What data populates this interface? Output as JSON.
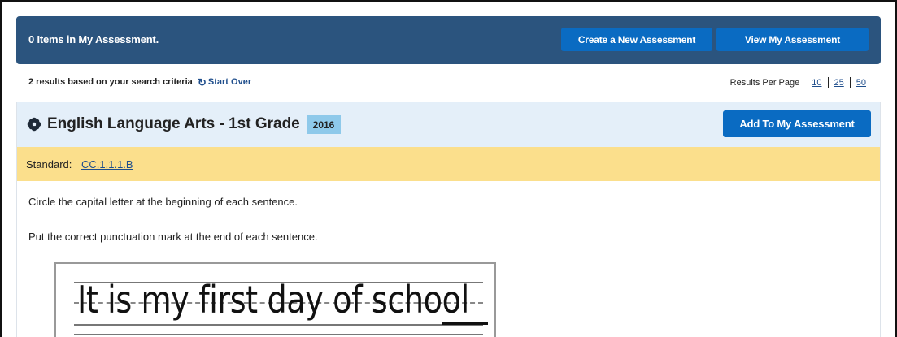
{
  "topbar": {
    "items_count_text": "0 Items in My Assessment.",
    "create_label": "Create a New Assessment",
    "view_label": "View My Assessment"
  },
  "results": {
    "summary": "2 results based on your search criteria",
    "start_over_label": "Start Over",
    "per_page_label": "Results Per Page",
    "per_page_options": [
      "10",
      "25",
      "50"
    ]
  },
  "item": {
    "icon": "flower-icon",
    "title": "English Language Arts - 1st Grade",
    "year": "2016",
    "add_label": "Add To My Assessment",
    "standard_label": "Standard:",
    "standard_code": "CC.1.1.1.B",
    "instruction_1": "Circle the capital letter at the beginning of each sentence.",
    "instruction_2": "Put the correct punctuation mark at the end of each sentence.",
    "worksheet_sentence": "It is my first day of school"
  },
  "colors": {
    "topbar_bg": "#2b547e",
    "button_blue": "#0a6bc2",
    "card_head_bg": "#e4eff9",
    "standard_bg": "#fbdf8c",
    "year_badge_bg": "#8ec9ea"
  }
}
